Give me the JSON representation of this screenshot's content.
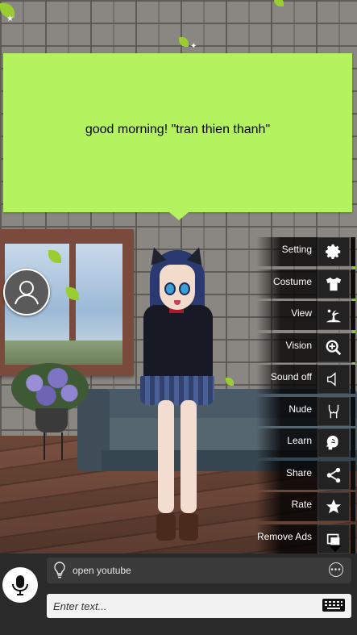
{
  "speech_bubble": {
    "text": "good morning!  \"tran thien thanh\""
  },
  "side_menu": {
    "items": [
      {
        "label": "Setting",
        "icon": "gear-icon"
      },
      {
        "label": "Costume",
        "icon": "shirt-icon"
      },
      {
        "label": "View",
        "icon": "scenery-icon"
      },
      {
        "label": "Vision",
        "icon": "zoom-icon"
      },
      {
        "label": "Sound off",
        "icon": "speaker-icon"
      },
      {
        "label": "Nude",
        "icon": "body-icon"
      },
      {
        "label": "Learn",
        "icon": "brain-icon"
      },
      {
        "label": "Share",
        "icon": "share-icon"
      },
      {
        "label": "Rate",
        "icon": "star-icon"
      },
      {
        "label": "Remove Ads",
        "icon": "remove-ads-icon"
      }
    ]
  },
  "suggestion": {
    "text": "open youtube"
  },
  "chat_input": {
    "placeholder": "Enter text..."
  },
  "colors": {
    "bubble": "#b4f25f",
    "menu_accent": "#8bc34a",
    "bottom_bar": "#2a2a2a"
  }
}
